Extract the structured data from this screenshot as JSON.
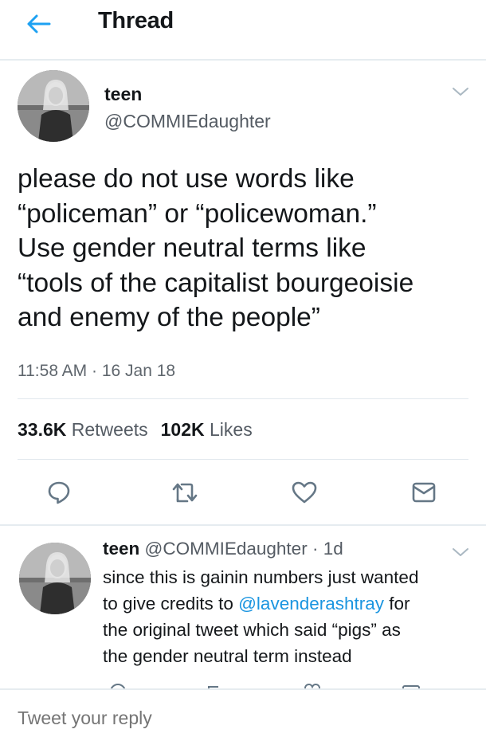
{
  "header": {
    "title": "Thread",
    "back_icon": "arrow-left-icon",
    "accent_color": "#1da1f2"
  },
  "main_tweet": {
    "display_name": "teen",
    "handle": "@COMMIEdaughter",
    "text_lines": [
      "please do not use words like",
      "“policeman” or “policewoman.”",
      "Use gender neutral terms like",
      "“tools of the capitalist bourgeoisie",
      "and enemy of the people”"
    ],
    "timestamp": "11:58 AM · 16 Jan 18",
    "stats": {
      "retweets_count": "33.6K",
      "retweets_label": "Retweets",
      "likes_count": "102K",
      "likes_label": "Likes"
    },
    "actions": [
      "reply-icon",
      "retweet-icon",
      "heart-icon",
      "direct-message-icon"
    ]
  },
  "reply_tweet": {
    "display_name": "teen",
    "handle": "@COMMIEdaughter",
    "separator": " · ",
    "age": "1d",
    "line1": "since this is gainin numbers just wanted",
    "line2_prefix": "to give credits to ",
    "line2_mention": "@lavenderashtray",
    "line2_suffix": " for",
    "line3": "the original tweet which said “pigs” as",
    "line4": "the gender neutral term instead"
  },
  "compose": {
    "placeholder": "Tweet your reply"
  }
}
